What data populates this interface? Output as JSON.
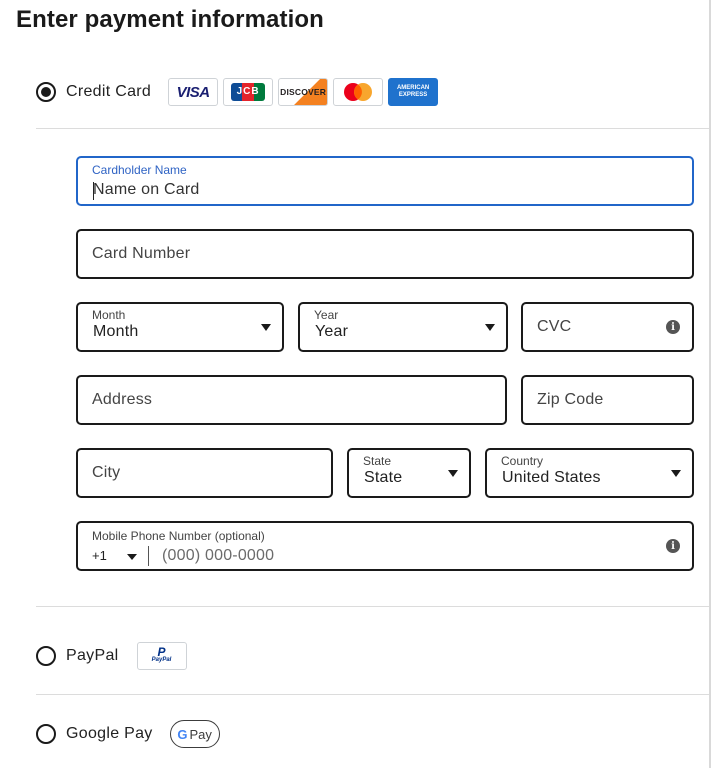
{
  "title": "Enter payment information",
  "methods": {
    "credit_card": {
      "label": "Credit Card",
      "selected": true
    },
    "paypal": {
      "label": "PayPal",
      "selected": false,
      "badge_text": "PayPal"
    },
    "google_pay": {
      "label": "Google Pay",
      "selected": false,
      "badge_g": "G",
      "badge_text": "Pay"
    }
  },
  "card_logos": {
    "visa": "VISA",
    "jcb": "JCB",
    "discover": "DISCOVER",
    "mastercard": "mastercard",
    "amex_line1": "AMERICAN",
    "amex_line2": "EXPRESS"
  },
  "form": {
    "cardholder": {
      "label": "Cardholder Name",
      "value": "Name on Card"
    },
    "card_number": {
      "placeholder": "Card Number"
    },
    "month": {
      "label": "Month",
      "value": "Month"
    },
    "year": {
      "label": "Year",
      "value": "Year"
    },
    "cvc": {
      "placeholder": "CVC",
      "info_icon": "info-icon"
    },
    "address": {
      "placeholder": "Address"
    },
    "zip": {
      "placeholder": "Zip Code"
    },
    "city": {
      "placeholder": "City"
    },
    "state": {
      "label": "State",
      "value": "State"
    },
    "country": {
      "label": "Country",
      "value": "United States"
    },
    "phone": {
      "label": "Mobile Phone Number (optional)",
      "code": "+1",
      "placeholder": "(000) 000-0000",
      "info_icon": "info-icon"
    }
  },
  "colors": {
    "focus": "#2166c9",
    "amex_blue": "#1f72cd",
    "visa_blue": "#1a1f71",
    "mc_red": "#eb001b",
    "mc_orange": "#f79e1b",
    "discover_orange": "#f48120"
  }
}
